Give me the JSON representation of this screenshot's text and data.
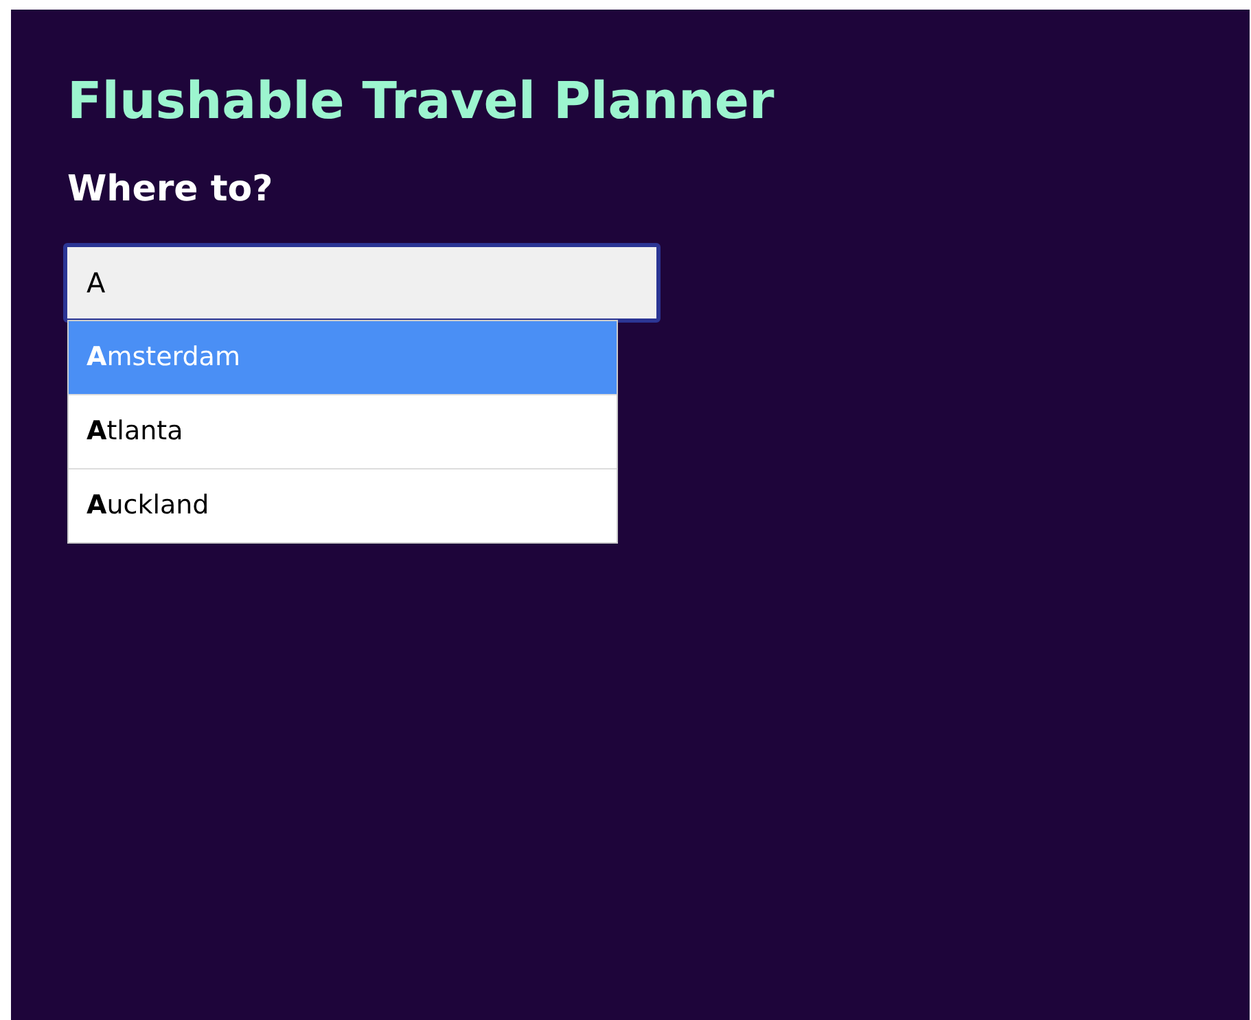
{
  "title": "Flushable Travel Planner",
  "heading": "Where to?",
  "search": {
    "value": "A",
    "focused": true
  },
  "suggestions": [
    {
      "label": "**A**msterdam",
      "selected": true
    },
    {
      "label": "**A**tlanta",
      "selected": false
    },
    {
      "label": "**A**uckland",
      "selected": false
    }
  ]
}
